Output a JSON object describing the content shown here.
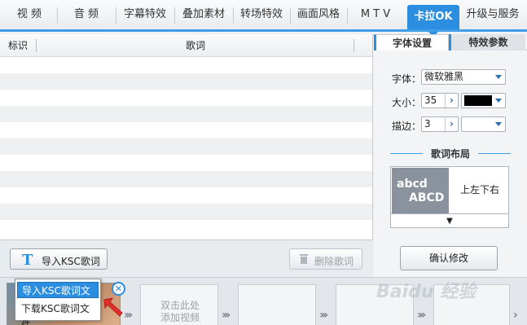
{
  "topnav": {
    "tabs": [
      "视 频",
      "音 频",
      "字幕特效",
      "叠加素材",
      "转场特效",
      "画面风格",
      "M T V",
      "卡拉OK",
      "升级与服务"
    ],
    "active": "卡拉OK"
  },
  "lyrics_table": {
    "columns": [
      "标识",
      "歌词"
    ],
    "rows": []
  },
  "right_panel": {
    "tabs": [
      "字体设置",
      "特效参数"
    ],
    "font_label": "字体：",
    "font_value": "微软雅黑",
    "size_label": "大小：",
    "size_value": "35",
    "outline_label": "描边：",
    "outline_value": "3",
    "font_color": "#000000",
    "layout_title": "歌词布局",
    "layout_preview_line1": "abcd",
    "layout_preview_line2": "ABCD",
    "layout_name": "上左下右",
    "confirm_label": "确认修改"
  },
  "toolbar": {
    "import_label": "导入KSC歌词",
    "delete_label": "删除歌词"
  },
  "import_menu": {
    "items": [
      "导入KSC歌词文件",
      "下载KSC歌词文件"
    ],
    "selected": "导入KSC歌词文件"
  },
  "timeline": {
    "add_hint_line1": "双击此处",
    "add_hint_line2": "添加视频"
  },
  "watermark": "Baidu 经验"
}
